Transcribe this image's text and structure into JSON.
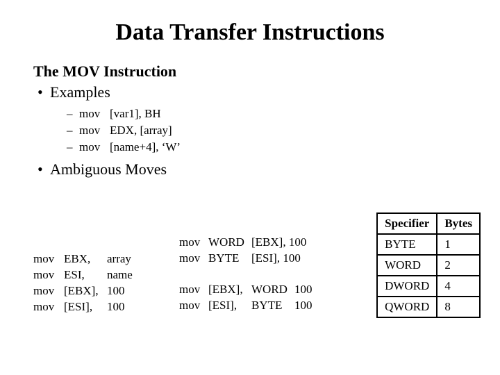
{
  "title": "Data Transfer Instructions",
  "subtitle": "The MOV Instruction",
  "bullet_examples": "Examples",
  "examples": {
    "e0": {
      "kw": "mov",
      "args": "[var1], BH"
    },
    "e1": {
      "kw": "mov",
      "args": "EDX, [array]"
    },
    "e2": {
      "kw": "mov",
      "args": "[name+4], ‘W’"
    }
  },
  "bullet_ambiguous": "Ambiguous Moves",
  "left_code": {
    "l0": {
      "kw": "mov",
      "op1": "EBX,",
      "op2": "array"
    },
    "l1": {
      "kw": "mov",
      "op1": "ESI,",
      "op2": "name"
    },
    "l2": {
      "kw": "mov",
      "op1": "[EBX],",
      "op2": "100"
    },
    "l3": {
      "kw": "mov",
      "op1": "[ESI],",
      "op2": "100"
    }
  },
  "mid_code_top": {
    "m0": {
      "kw": "mov",
      "spec": "WORD",
      "rest": "[EBX], 100"
    },
    "m1": {
      "kw": "mov",
      "spec": "BYTE",
      "rest": "[ESI], 100"
    }
  },
  "mid_code_bot": {
    "b0": {
      "kw": "mov",
      "addr": "[EBX],",
      "spec": "WORD",
      "val": "100"
    },
    "b1": {
      "kw": "mov",
      "addr": "[ESI],",
      "spec": "BYTE",
      "val": "100"
    }
  },
  "table": {
    "head_spec": "Specifier",
    "head_bytes": "Bytes",
    "rows": {
      "r0": {
        "spec": "BYTE",
        "bytes": "1"
      },
      "r1": {
        "spec": "WORD",
        "bytes": "2"
      },
      "r2": {
        "spec": "DWORD",
        "bytes": "4"
      },
      "r3": {
        "spec": "QWORD",
        "bytes": "8"
      }
    }
  }
}
